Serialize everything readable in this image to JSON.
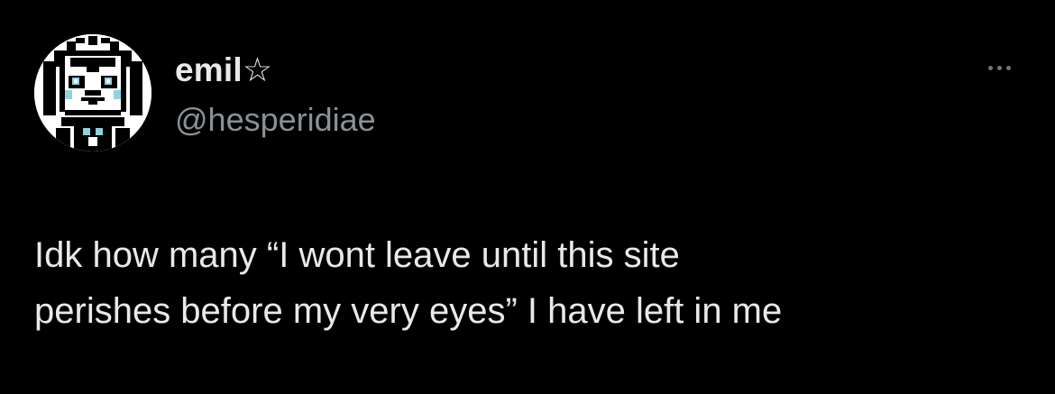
{
  "tweet": {
    "author": {
      "display_name": "emil☆",
      "handle": "@hesperidiae",
      "avatar_icon": "pixel-art-character-avatar"
    },
    "more_icon": "more-options-ellipsis-icon",
    "text_lines": [
      "Idk how many “I wont leave until this site",
      "perishes before my very eyes” I have left in me"
    ]
  },
  "colors": {
    "background": "#000000",
    "primary_text": "#e7e9ea",
    "secondary_text": "#8b9096",
    "avatar_accent": "#8fd3dc"
  }
}
